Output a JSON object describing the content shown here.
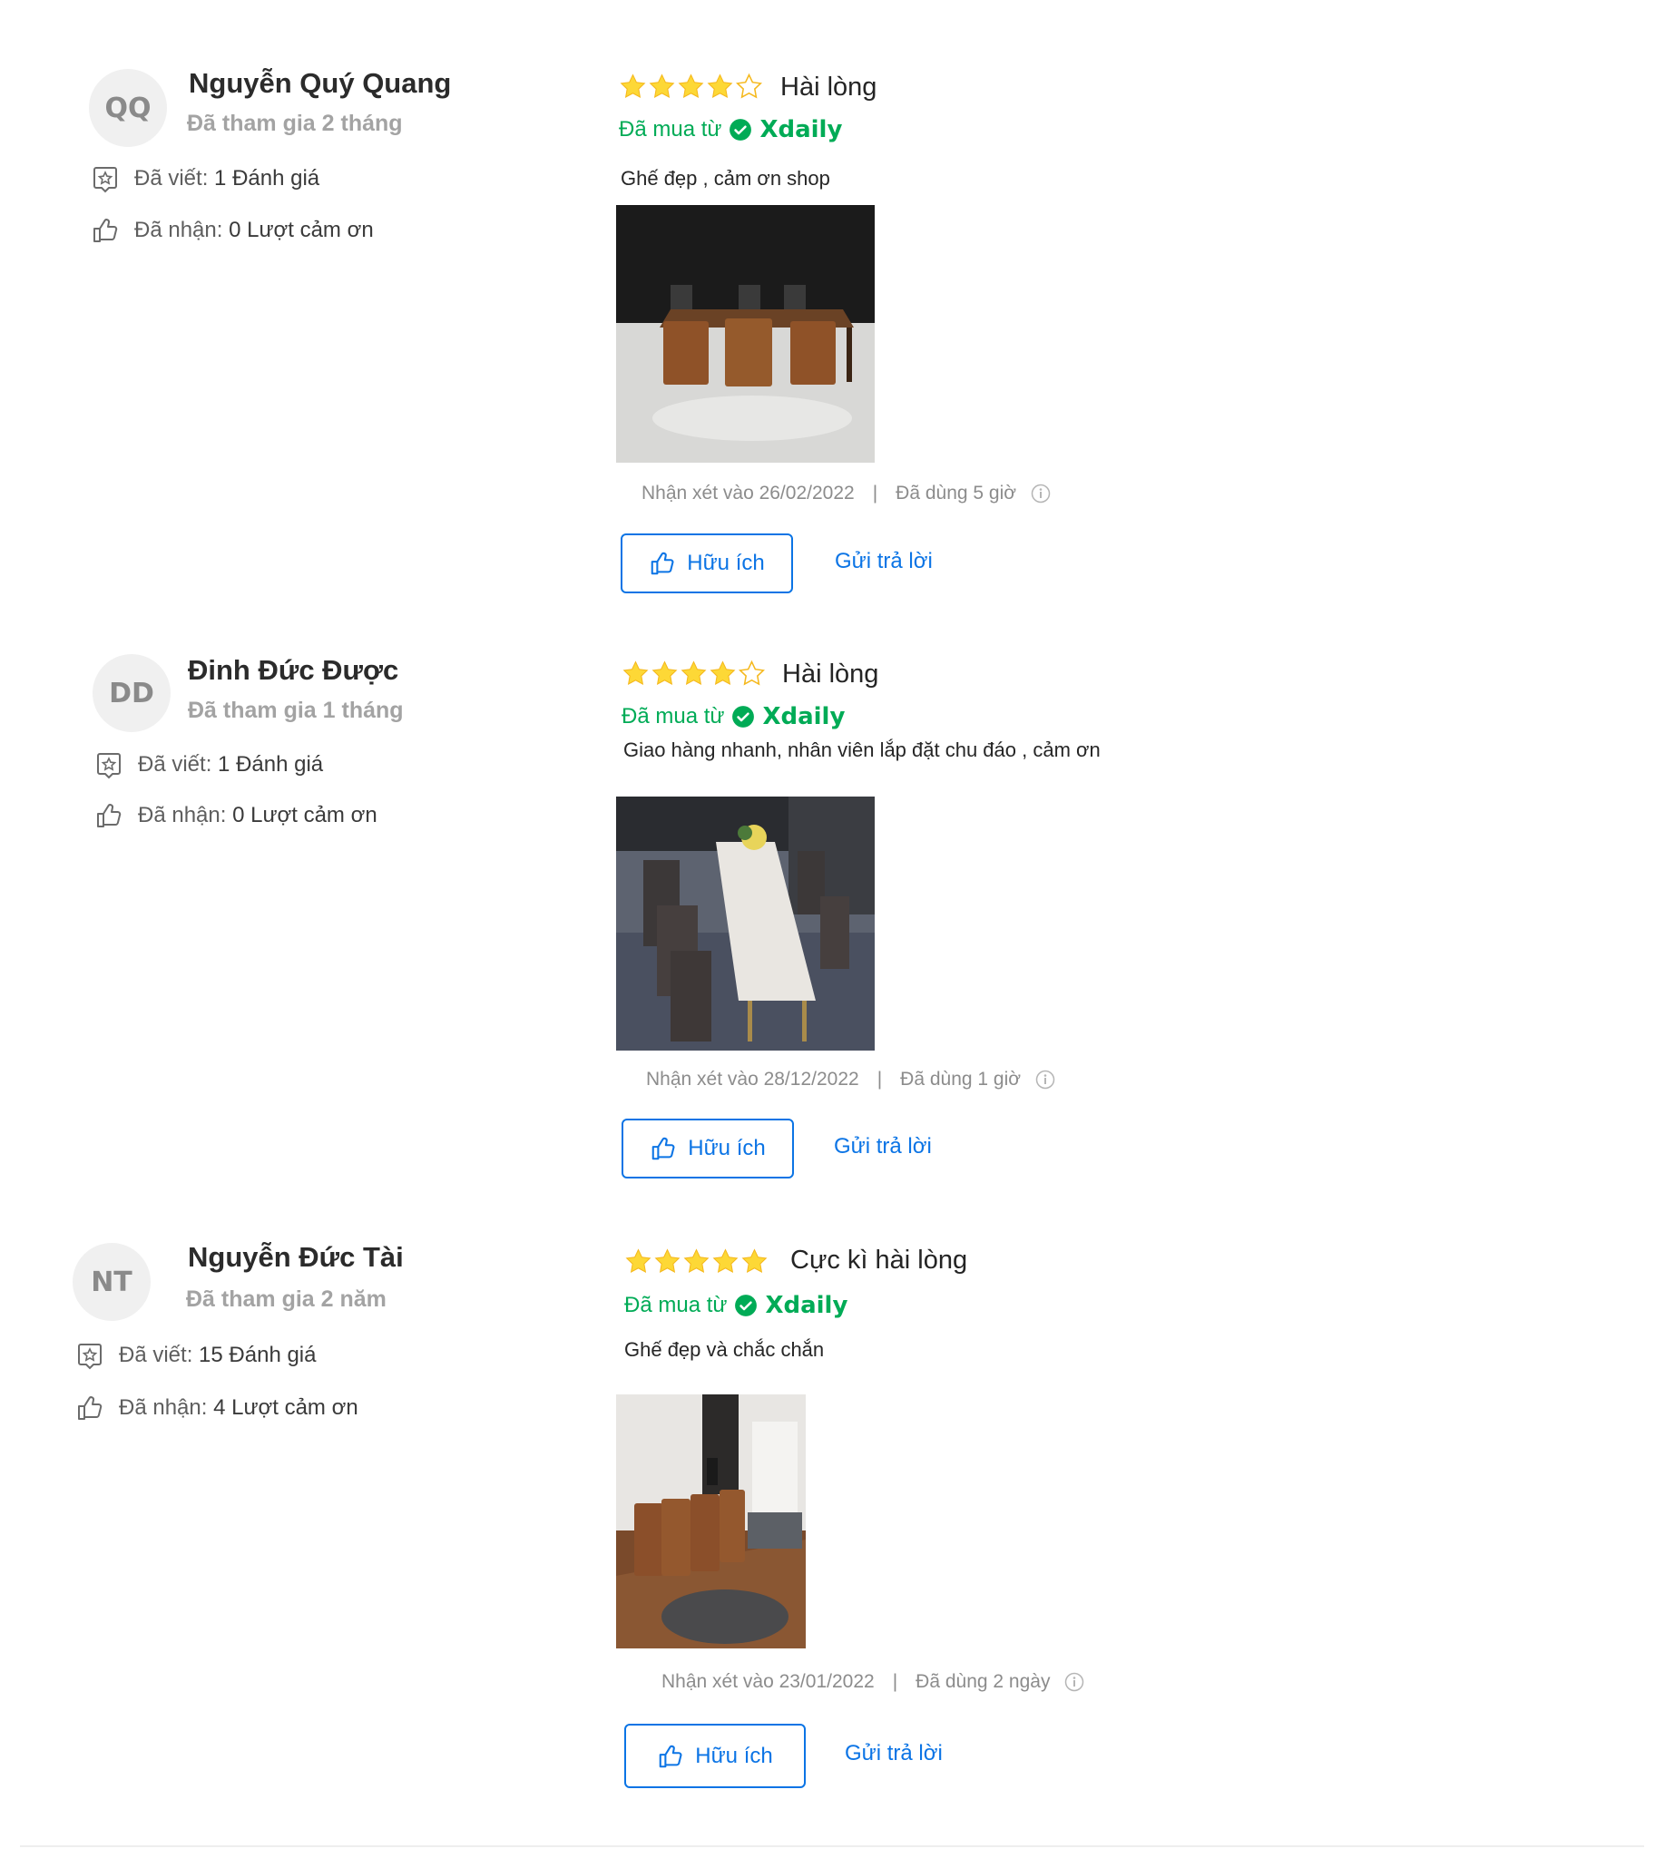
{
  "reviews": [
    {
      "initials": "QQ",
      "name": "Nguyễn Quý Quang",
      "joined": "Đã tham gia 2 tháng",
      "written_label": "Đã viết:",
      "written_value": "1 Đánh giá",
      "received_label": "Đã nhận:",
      "received_value": "0 Lượt cảm ơn",
      "rating": 4,
      "rating_text": "Hài lòng",
      "bought_label": "Đã mua từ",
      "shop": "Xdaily",
      "comment": "Ghế đẹp , cảm ơn shop",
      "photo_icon": "dining-table-brown-chairs-photo",
      "date": "Nhận xét vào 26/02/2022",
      "used": "Đã dùng 5 giờ",
      "helpful": "Hữu ích",
      "reply": "Gửi trả lời"
    },
    {
      "initials": "DD",
      "name": "Đinh Đức Được",
      "joined": "Đã tham gia 1 tháng",
      "written_label": "Đã viết:",
      "written_value": "1 Đánh giá",
      "received_label": "Đã nhận:",
      "received_value": "0 Lượt cảm ơn",
      "rating": 4,
      "rating_text": "Hài lòng",
      "bought_label": "Đã mua từ",
      "shop": "Xdaily",
      "comment": "Giao hàng nhanh, nhân viên lắp đặt chu đáo , cảm ơn",
      "photo_icon": "marble-table-dark-chairs-photo",
      "date": "Nhận xét vào 28/12/2022",
      "used": "Đã dùng 1 giờ",
      "helpful": "Hữu ích",
      "reply": "Gửi trả lời"
    },
    {
      "initials": "NT",
      "name": "Nguyễn Đức Tài",
      "joined": "Đã tham gia 2 năm",
      "written_label": "Đã viết:",
      "written_value": "15 Đánh giá",
      "received_label": "Đã nhận:",
      "received_value": "4 Lượt cảm ơn",
      "rating": 5,
      "rating_text": "Cực kì hài lòng",
      "bought_label": "Đã mua từ",
      "shop": "Xdaily",
      "comment": "Ghế đẹp và chắc chắn",
      "photo_icon": "room-brown-chairs-photo",
      "date": "Nhận xét vào 23/01/2022",
      "used": "Đã dùng 2 ngày",
      "helpful": "Hữu ích",
      "reply": "Gửi trả lời"
    }
  ],
  "colors": {
    "star": "#fdd836",
    "accent": "#0b74e5",
    "bought": "#00ab56"
  }
}
